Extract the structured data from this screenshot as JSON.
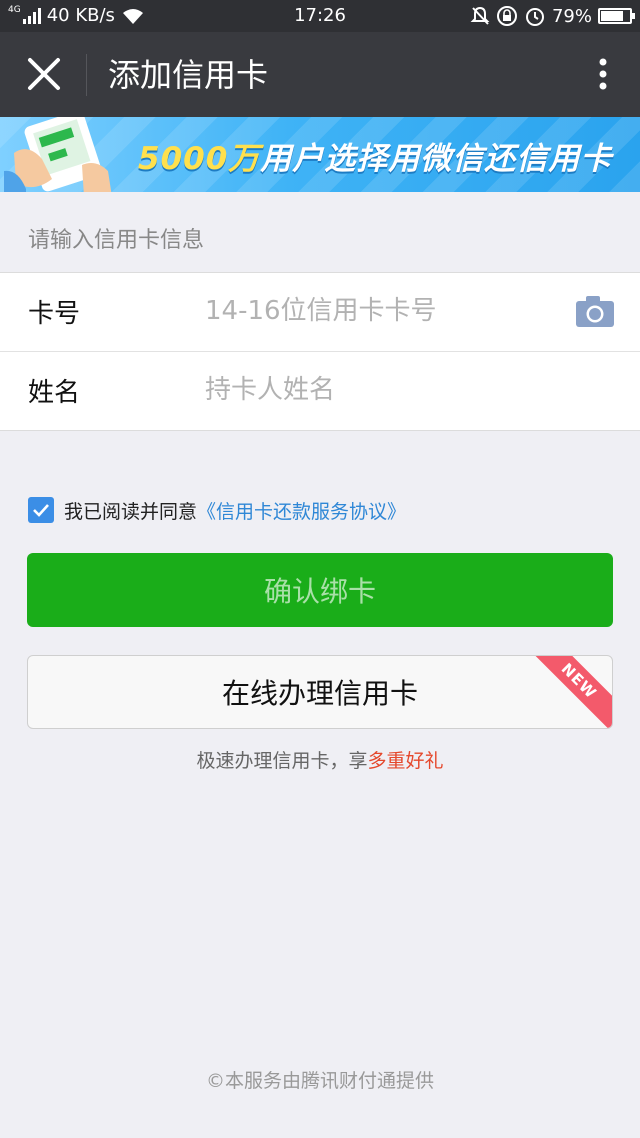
{
  "status_bar": {
    "network": "4G",
    "speed": "40 KB/s",
    "time": "17:26",
    "battery": "79%",
    "battery_level": 0.79,
    "icons": [
      "signal-icon",
      "wifi-icon",
      "mute-icon",
      "rotation-lock-icon",
      "alarm-icon",
      "battery-icon"
    ]
  },
  "nav": {
    "title": "添加信用卡",
    "close_icon": "close-icon",
    "more_icon": "more-vertical-icon"
  },
  "banner": {
    "highlight": "5000万",
    "text": "用户选择用微信还信用卡"
  },
  "form": {
    "section_label": "请输入信用卡信息",
    "card_number": {
      "label": "卡号",
      "placeholder": "14-16位信用卡卡号",
      "value": ""
    },
    "name": {
      "label": "姓名",
      "placeholder": "持卡人姓名",
      "value": ""
    },
    "camera_icon": "camera-icon"
  },
  "agreement": {
    "checked": true,
    "text": "我已阅读并同意",
    "link": "《信用卡还款服务协议》"
  },
  "buttons": {
    "confirm": "确认绑卡",
    "online_apply": "在线办理信用卡",
    "new_badge": "NEW"
  },
  "promo": {
    "text": "极速办理信用卡，享",
    "highlight": "多重好礼"
  },
  "footer": "©本服务由腾讯财付通提供",
  "colors": {
    "nav_bg": "#393a3f",
    "confirm_green": "#1aad19",
    "link_blue": "#2f87d6",
    "promo_red": "#e5482c",
    "checkbox_blue": "#3b8ee6"
  }
}
